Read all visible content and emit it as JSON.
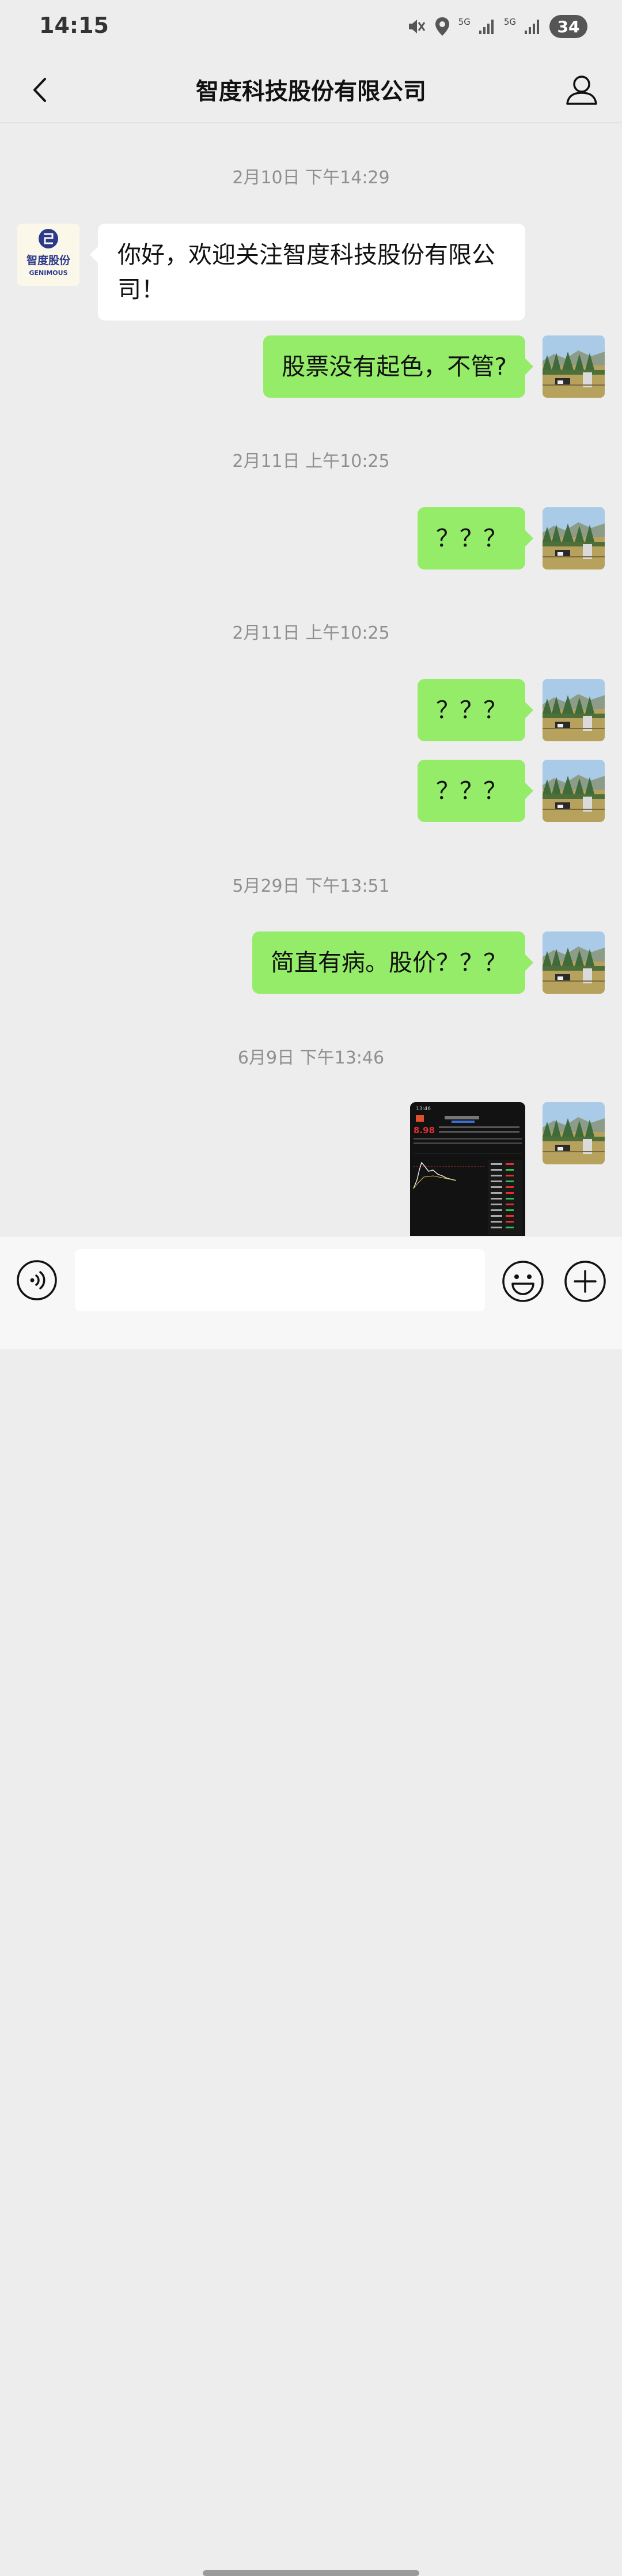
{
  "status_bar": {
    "time": "14:15",
    "network_1": "5G",
    "network_2": "5G",
    "battery": "34",
    "icons": [
      "mute-icon",
      "location-icon",
      "signal-icon",
      "signal-icon",
      "battery-icon"
    ]
  },
  "header": {
    "title": "智度科技股份有限公司",
    "back_icon": "chevron-left-icon",
    "profile_icon": "user-icon"
  },
  "company_avatar": {
    "logo_text": "智度股份",
    "logo_subtext": "GENIMOUS"
  },
  "messages": [
    {
      "type": "timestamp",
      "text": "2月10日 下午14:29"
    },
    {
      "type": "incoming",
      "text": "你好，欢迎关注智度科技股份有限公司！"
    },
    {
      "type": "outgoing",
      "text": "股票没有起色，不管?"
    },
    {
      "type": "timestamp",
      "text": "2月11日 上午10:25"
    },
    {
      "type": "outgoing",
      "text": "？？？"
    },
    {
      "type": "timestamp",
      "text": "2月11日 上午10:25"
    },
    {
      "type": "outgoing",
      "text": "？？？"
    },
    {
      "type": "outgoing",
      "text": "？？？"
    },
    {
      "type": "timestamp",
      "text": "5月29日 下午13:51"
    },
    {
      "type": "outgoing",
      "text": "简直有病。股价？？？"
    },
    {
      "type": "timestamp",
      "text": "6月9日 下午13:46"
    },
    {
      "type": "outgoing-image",
      "content": "stock-app-screenshot",
      "price": "8.98",
      "clock": "13:46"
    }
  ],
  "input_bar": {
    "value": "",
    "voice_icon": "voice-icon",
    "emoji_icon": "emoji-icon",
    "plus_icon": "plus-icon"
  },
  "colors": {
    "background": "#ededed",
    "outgoing_bubble": "#95ec69",
    "incoming_bubble": "#ffffff",
    "timestamp": "#8f8f8f",
    "logo_blue": "#2b3a8c"
  }
}
